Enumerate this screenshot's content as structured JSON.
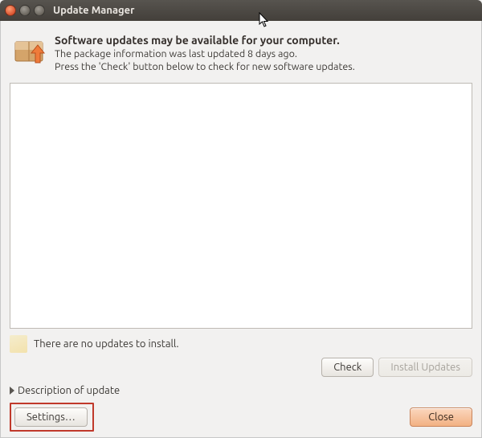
{
  "window": {
    "title": "Update Manager"
  },
  "header": {
    "title": "Software updates may be available for your computer.",
    "line1": "The package information was last updated 8 days ago.",
    "line2": "Press the 'Check' button below to check for new software updates."
  },
  "status": {
    "text": "There are no updates to install."
  },
  "buttons": {
    "check": "Check",
    "install": "Install Updates",
    "settings": "Settings…",
    "close": "Close"
  },
  "expander": {
    "label": "Description of update"
  }
}
